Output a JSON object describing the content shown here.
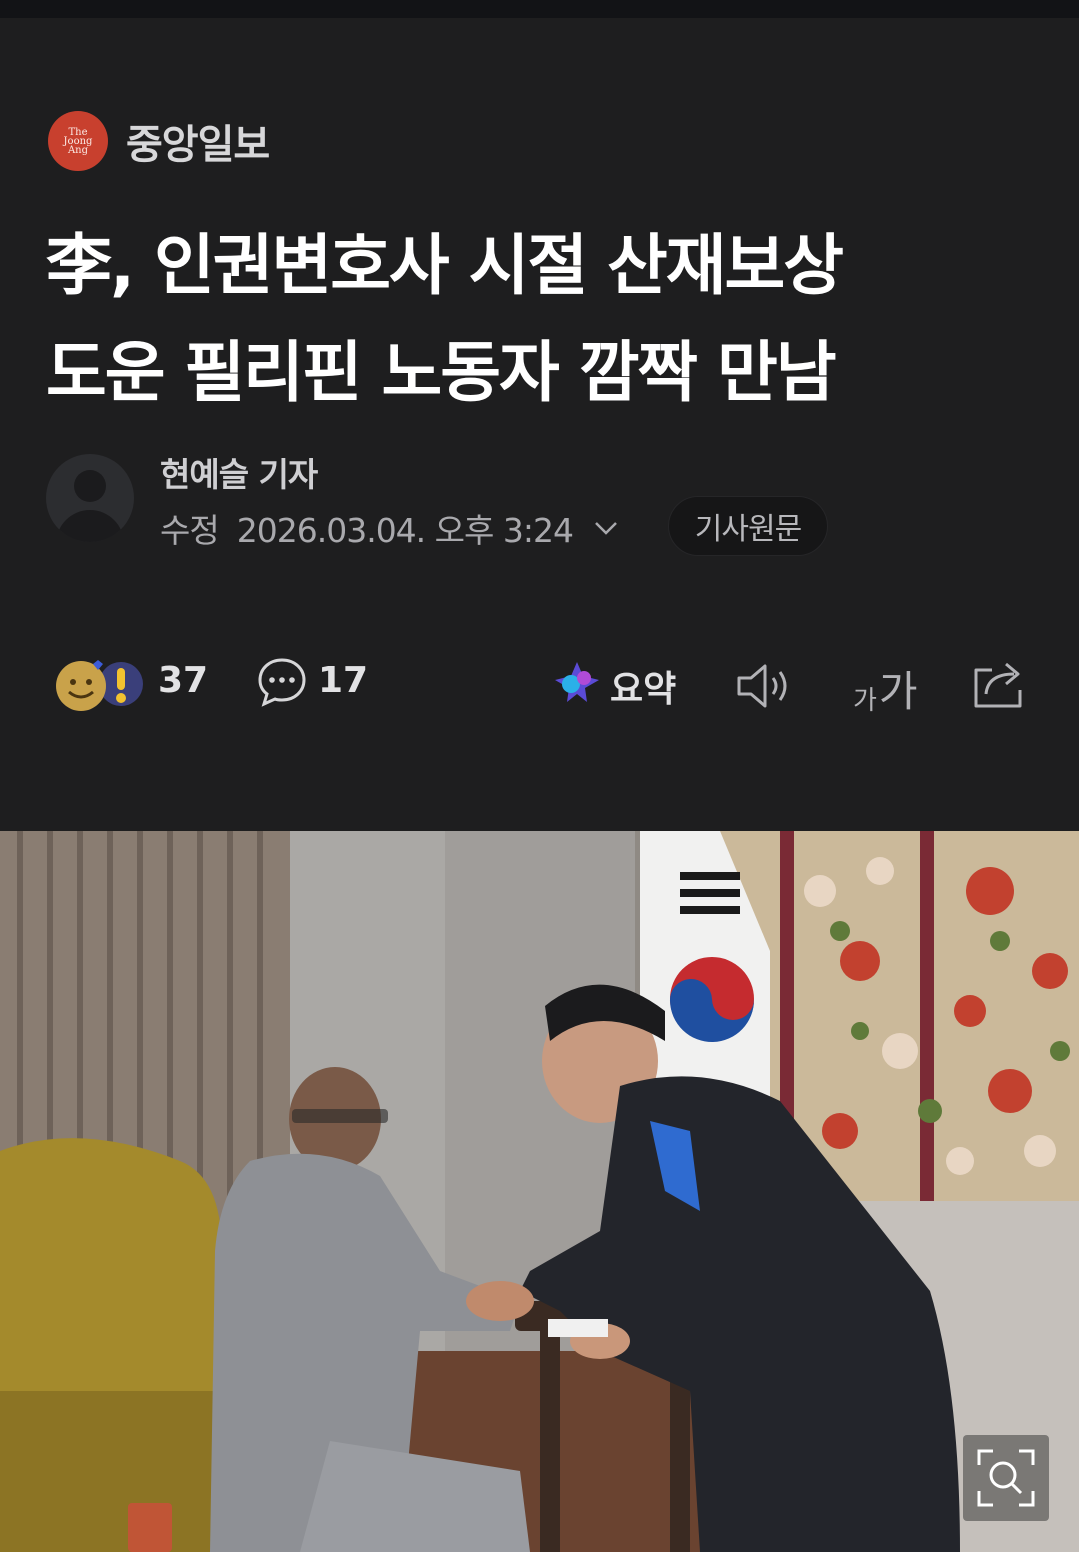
{
  "publisher": {
    "logo_lines": [
      "The",
      "Joong",
      "Ang"
    ],
    "name": "중앙일보"
  },
  "article": {
    "headline_line1": "李, 인권변호사 시절 산재보상",
    "headline_line2": "도운 필리핀 노동자 깜짝 만남"
  },
  "byline": {
    "reporter": "현예슬 기자",
    "modified_label": "수정",
    "date": "2026.03.04. 오후 3:24",
    "original_button": "기사원문"
  },
  "actions": {
    "reaction_count": "37",
    "comment_count": "17",
    "summary_label": "요약",
    "font_small": "가",
    "font_large": "가"
  },
  "colors": {
    "background": "#1e1e1f",
    "logo_red": "#c8402e",
    "text_primary": "#ffffff",
    "text_secondary": "#a9a9ad"
  }
}
